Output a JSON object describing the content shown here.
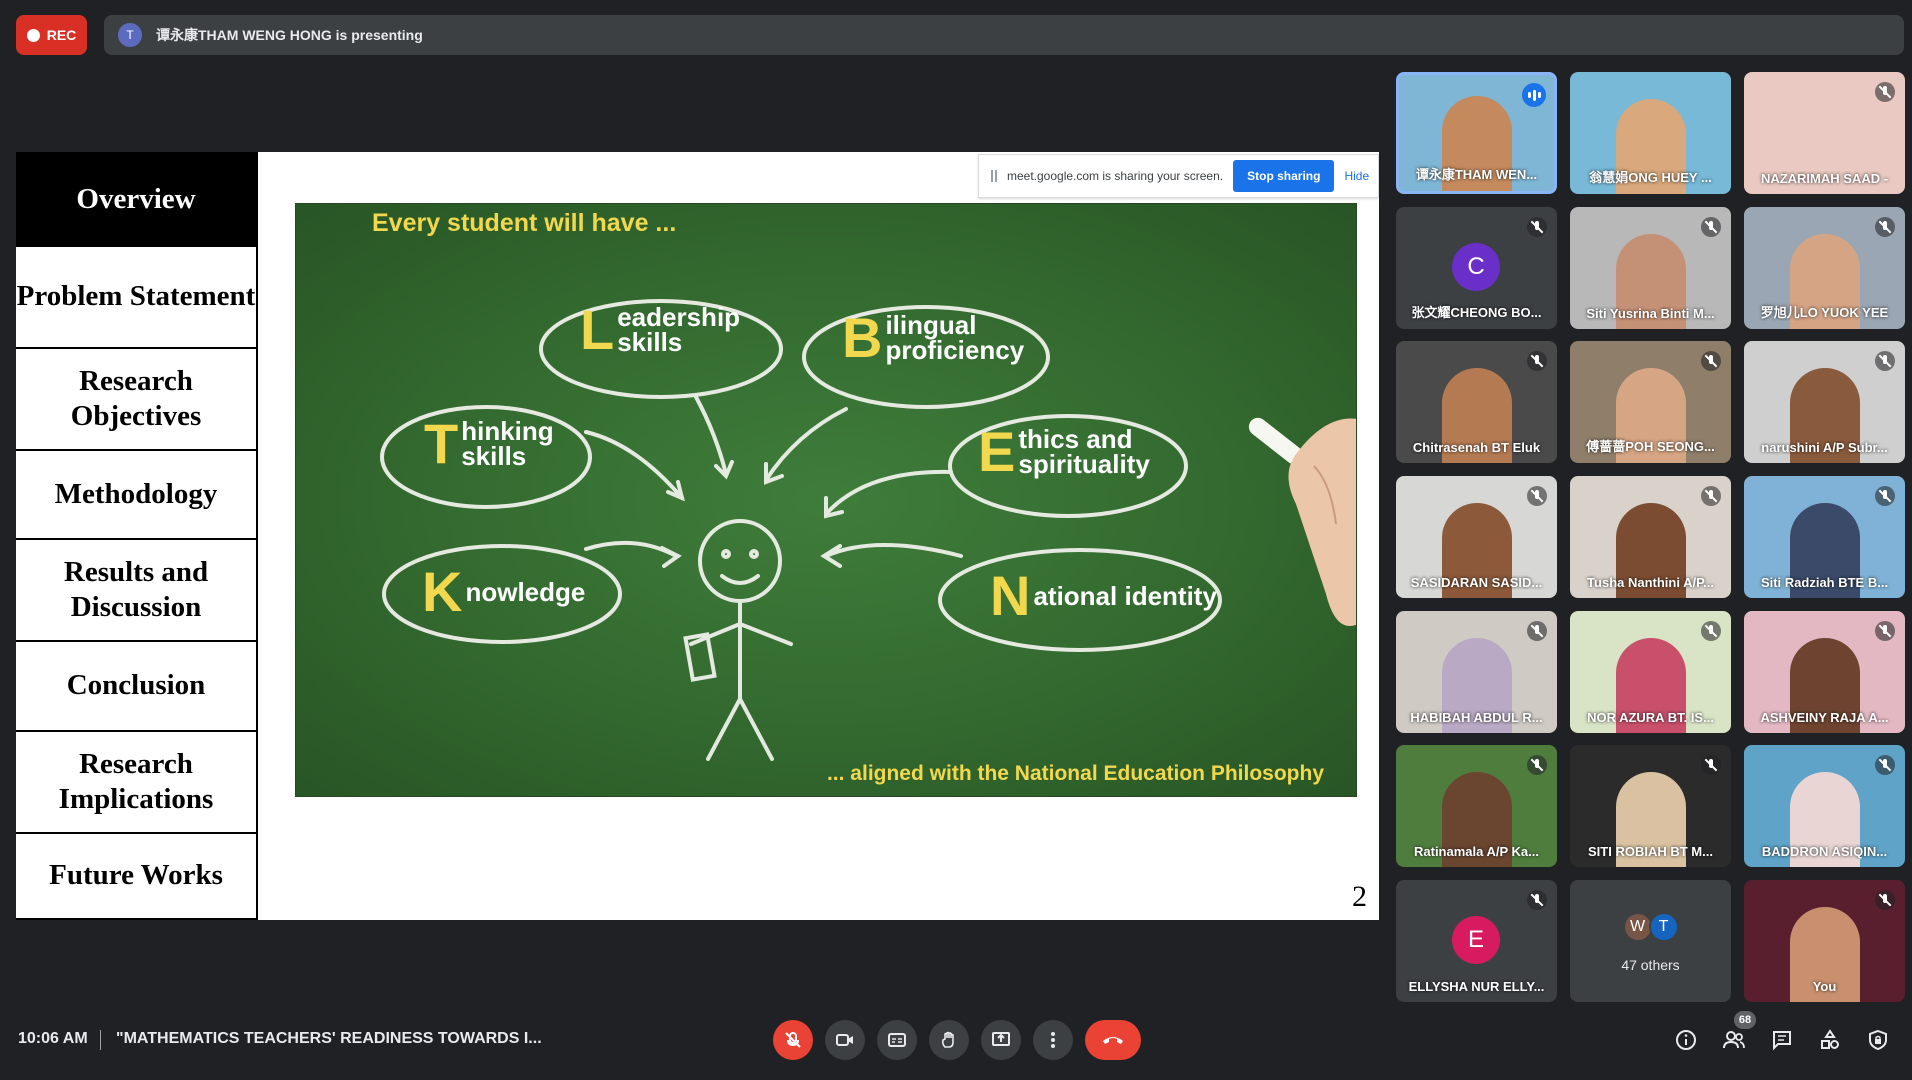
{
  "topbar": {
    "rec_label": "REC",
    "presenter_initial": "T",
    "presenting_text": "谭永康THAM WENG HONG is presenting"
  },
  "slide": {
    "nav": [
      "Overview",
      "Problem Statement",
      "Research Objectives",
      "Methodology",
      "Results and Discussion",
      "Conclusion",
      "Research Implications",
      "Future Works"
    ],
    "page_number": "2",
    "board_title": "Every student will have ...",
    "board_footer": "... aligned with the National Education Philosophy",
    "bubbles": [
      {
        "letter": "L",
        "rest": "eadership\nskills"
      },
      {
        "letter": "B",
        "rest": "ilingual\nproficiency"
      },
      {
        "letter": "T",
        "rest": "hinking\nskills"
      },
      {
        "letter": "E",
        "rest": "thics and\nspirituality"
      },
      {
        "letter": "K",
        "rest": "nowledge"
      },
      {
        "letter": "N",
        "rest": "ational identity"
      }
    ]
  },
  "share_banner": {
    "text": "meet.google.com is sharing your screen.",
    "stop_label": "Stop sharing",
    "hide_label": "Hide"
  },
  "participants": [
    {
      "name": "谭永康THAM WEN...",
      "speaking": true,
      "bg": "#7fb6d6",
      "skin": "#c48a5e"
    },
    {
      "name": "翁慧娟ONG HUEY ...",
      "muted": false,
      "bg": "#78b9d8",
      "skin": "#d9a87c"
    },
    {
      "name": "NAZARIMAH SAAD -",
      "muted": true,
      "bg": "#e9c9c2"
    },
    {
      "name": "张文耀CHEONG BO...",
      "muted": true,
      "avatar": "C",
      "avatar_color": "#6a2fc9"
    },
    {
      "name": "Siti Yusrina Binti M...",
      "muted": true,
      "bg": "#b8b8b8",
      "skin": "#c59176"
    },
    {
      "name": "罗旭儿LO YUOK YEE",
      "muted": true,
      "bg": "#9aa6b3",
      "skin": "#d4a485"
    },
    {
      "name": "Chitrasenah BT Eluk",
      "muted": true,
      "bg": "#4a4a4a",
      "skin": "#b47a52"
    },
    {
      "name": "傅蔷蔷POH SEONG...",
      "muted": true,
      "bg": "#8f7f6a",
      "skin": "#d6a583"
    },
    {
      "name": "narushini A/P Subr...",
      "muted": true,
      "bg": "#cfcfcf",
      "skin": "#8a5a3c"
    },
    {
      "name": "SASIDARAN SASID...",
      "muted": true,
      "bg": "#d7d7d5",
      "skin": "#8c5a3a"
    },
    {
      "name": "Tusha Nanthini A/P...",
      "muted": true,
      "bg": "#d9d2cb",
      "skin": "#7b4c32"
    },
    {
      "name": "Siti Radziah BTE B...",
      "muted": true,
      "bg": "#7fb2d6",
      "skin": "#3a4a68"
    },
    {
      "name": "HABIBAH ABDUL R...",
      "muted": true,
      "bg": "#cfcac4",
      "skin": "#b9a9c4"
    },
    {
      "name": "NOR AZURA BT. IS...",
      "muted": true,
      "bg": "#d9e4c6",
      "skin": "#c8506a"
    },
    {
      "name": "ASHVEINY RAJA A...",
      "muted": true,
      "bg": "#e3b8c2",
      "skin": "#6e4430"
    },
    {
      "name": "Ratinamala A/P Ka...",
      "muted": true,
      "bg": "#4f7d3e",
      "skin": "#6a4530"
    },
    {
      "name": "SITI ROBIAH BT M...",
      "muted": true,
      "bg": "#2b2b2b",
      "skin": "#d9c1a1"
    },
    {
      "name": "BADDRON ASIQIN...",
      "muted": true,
      "bg": "#5fa3c8",
      "skin": "#e9d6d4"
    },
    {
      "name": "ELLYSHA NUR ELLY...",
      "muted": true,
      "avatar": "E",
      "avatar_color": "#d81b60"
    },
    {
      "name": "47 others",
      "others": true
    },
    {
      "name": "You",
      "muted": true,
      "bg": "#5a1f2e",
      "skin": "#c8906e"
    }
  ],
  "others_avatars": [
    {
      "initial": "W",
      "color": "#795548"
    },
    {
      "initial": "T",
      "color": "#1565c0"
    }
  ],
  "bottombar": {
    "time": "10:06 AM",
    "meeting_title": "\"MATHEMATICS TEACHERS' READINESS TOWARDS I...",
    "people_count": "68"
  },
  "colors": {
    "background": "#202124",
    "accent_red": "#ea4335",
    "accent_blue": "#1a73e8",
    "chalk_yellow": "#f2d84e"
  }
}
